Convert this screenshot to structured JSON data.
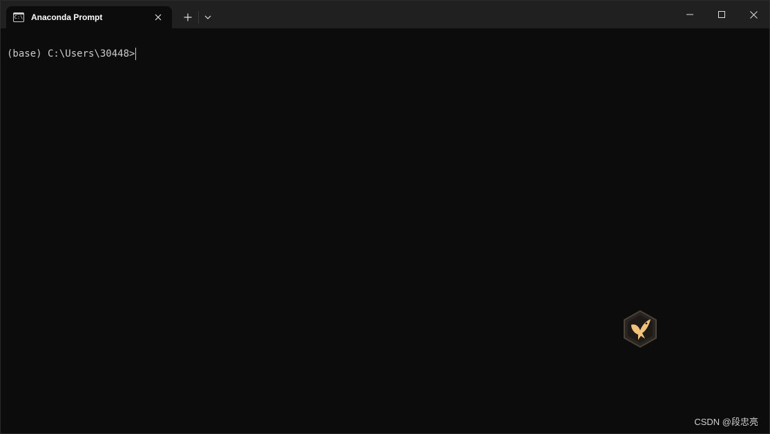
{
  "tab": {
    "icon": "terminal-icon",
    "icon_glyph": "C:\\",
    "title": "Anaconda Prompt",
    "close_icon": "close-icon"
  },
  "toolbar": {
    "new_tab_icon": "plus-icon",
    "dropdown_icon": "chevron-down-icon"
  },
  "window_controls": {
    "minimize_icon": "minimize-icon",
    "maximize_icon": "maximize-icon",
    "close_icon": "close-icon"
  },
  "console": {
    "prompt": "(base) C:\\Users\\30448>"
  },
  "overlay": {
    "badge_icon": "bird-icon",
    "badge_color": "#f2c27a"
  },
  "watermark": {
    "text": "CSDN @段忠亮"
  },
  "colors": {
    "titlebar_bg": "#202020",
    "console_bg": "#0c0c0c",
    "console_text": "#cccccc"
  }
}
